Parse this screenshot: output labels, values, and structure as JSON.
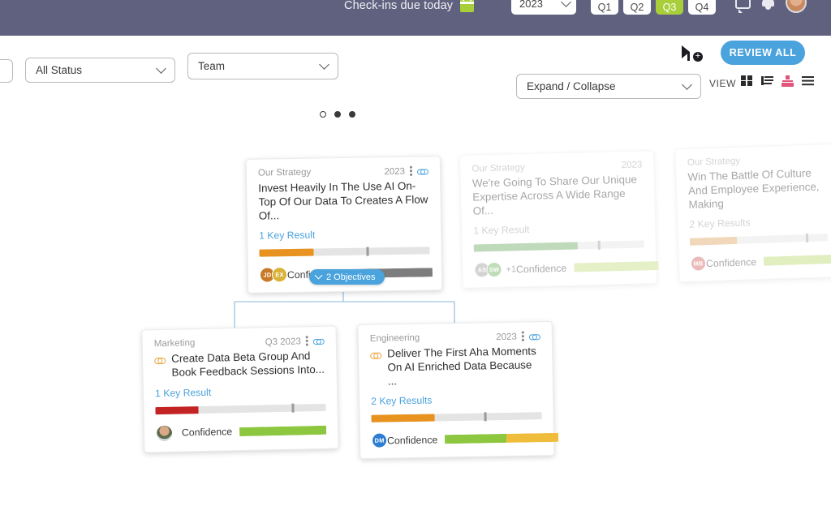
{
  "topnav": {
    "checkins_text": "Check-ins due today",
    "calendar_icon": "calendar-icon",
    "year_value": "2023",
    "quarters": [
      {
        "label": "Q1",
        "active": false
      },
      {
        "label": "Q2",
        "active": false
      },
      {
        "label": "Q3",
        "active": true
      },
      {
        "label": "Q4",
        "active": false
      }
    ],
    "icons": [
      "chat-icon",
      "bell-icon",
      "user-avatar"
    ],
    "bg_color": "#60617f",
    "active_quarter_color": "#a8cf3a"
  },
  "toolbar": {
    "status_filter": "All Status",
    "team_filter": "Team",
    "expand_collapse": "Expand / Collapse",
    "filter_icon": "filter-add-icon",
    "review_all_label": "REVIEW ALL",
    "review_all_color": "#4aa3dd",
    "view_label": "VIEW",
    "view_icons": [
      {
        "name": "grid-view-icon",
        "active": false
      },
      {
        "name": "list-view-icon",
        "active": false
      },
      {
        "name": "hierarchy-view-icon",
        "active": true
      },
      {
        "name": "lines-view-icon",
        "active": false
      }
    ],
    "active_view_color": "#e0557a"
  },
  "carousel": {
    "dots": [
      {
        "filled": false
      },
      {
        "filled": true
      },
      {
        "filled": true
      }
    ]
  },
  "tree": {
    "connector_color": "#aecde4",
    "objectives_pill": {
      "label": "2 Objectives",
      "chevron": "chevron-down-icon"
    }
  },
  "cards": [
    {
      "id": "card-strategy-ai",
      "owner": "Our Strategy",
      "period": "2023",
      "title": "Invest Heavily In The Use AI On-Top Of Our Data To Creates A Flow Of...",
      "key_results_label": "1 Key Result",
      "key_results_link_color": "#4aa3dd",
      "has_kebab": true,
      "has_link_icon": true,
      "link_icon_color": "#4aa3dd",
      "title_icon": null,
      "faded": false,
      "progress": {
        "fill_pct": 32,
        "fill_color": "#e8921f",
        "marker_pct": 63
      },
      "avatars": [
        {
          "initials": "JD",
          "color": "#c97a28"
        },
        {
          "initials": "EX",
          "color": "#d9b23a"
        }
      ],
      "extra_avatars": null,
      "photo_avatar": false,
      "confidence_label": "Confidence",
      "confidence_segments": [
        {
          "color": "#7d7d7d",
          "pct": 100
        }
      ],
      "confidence_width": 108
    },
    {
      "id": "card-strategy-expertise",
      "owner": "Our Strategy",
      "period": "2023",
      "title": "We're Going To Share Our Unique Expertise Across A Wide Range Of...",
      "key_results_label": "1 Key Result",
      "key_results_link_color": "#9a9a9a",
      "has_kebab": false,
      "has_link_icon": false,
      "link_icon_color": null,
      "title_icon": null,
      "faded": true,
      "progress": {
        "fill_pct": 61,
        "fill_color": "#69a85c",
        "marker_pct": 73
      },
      "avatars": [
        {
          "initials": "AS",
          "color": "#9a9a9a"
        },
        {
          "initials": "SW",
          "color": "#6cb05a"
        }
      ],
      "extra_avatars": "+1",
      "photo_avatar": false,
      "confidence_label": "Confidence",
      "confidence_segments": [
        {
          "color": "#c3dd7a",
          "pct": 100
        }
      ],
      "confidence_width": 104
    },
    {
      "id": "card-strategy-culture",
      "owner": "Our Strategy",
      "period": "",
      "title": "Win The Battle Of Culture And Employee Experience, Making",
      "key_results_label": "2 Key Results",
      "key_results_link_color": "#9a9a9a",
      "has_kebab": false,
      "has_link_icon": false,
      "link_icon_color": null,
      "title_icon": null,
      "faded": true,
      "progress": {
        "fill_pct": 34,
        "fill_color": "#e0a35e",
        "marker_pct": 84
      },
      "avatars": [
        {
          "initials": "MB",
          "color": "#d05f5f"
        }
      ],
      "extra_avatars": null,
      "photo_avatar": false,
      "confidence_label": "Confidence",
      "confidence_segments": [
        {
          "color": "#b7d96a",
          "pct": 100
        }
      ],
      "confidence_width": 90
    },
    {
      "id": "card-marketing-beta",
      "owner": "Marketing",
      "period": "Q3 2023",
      "title": "Create Data Beta Group And Book Feedback Sessions Into...",
      "key_results_label": "1 Key Result",
      "key_results_link_color": "#4aa3dd",
      "has_kebab": true,
      "has_link_icon": true,
      "link_icon_color": "#4aa3dd",
      "title_icon": "link-icon",
      "faded": false,
      "progress": {
        "fill_pct": 25,
        "fill_color": "#c42323",
        "marker_pct": 80
      },
      "avatars": [],
      "extra_avatars": null,
      "photo_avatar": true,
      "confidence_label": "Confidence",
      "confidence_segments": [
        {
          "color": "#8dc63f",
          "pct": 100
        }
      ],
      "confidence_width": 107
    },
    {
      "id": "card-engineering-aha",
      "owner": "Engineering",
      "period": "2023",
      "title": "Deliver The First Aha Moments On AI Enriched Data Because ...",
      "key_results_label": "2 Key Results",
      "key_results_link_color": "#4aa3dd",
      "has_kebab": true,
      "has_link_icon": true,
      "link_icon_color": "#4aa3dd",
      "title_icon": "link-icon",
      "faded": false,
      "progress": {
        "fill_pct": 37,
        "fill_color": "#e8921f",
        "marker_pct": 66
      },
      "avatars": [
        {
          "initials": "DM",
          "color": "#2e7fd4"
        }
      ],
      "extra_avatars": null,
      "photo_avatar": false,
      "confidence_label": "Confidence",
      "confidence_segments": [
        {
          "color": "#8dc63f",
          "pct": 54
        },
        {
          "color": "#f0bc3c",
          "pct": 46
        }
      ],
      "confidence_width": 140
    }
  ]
}
